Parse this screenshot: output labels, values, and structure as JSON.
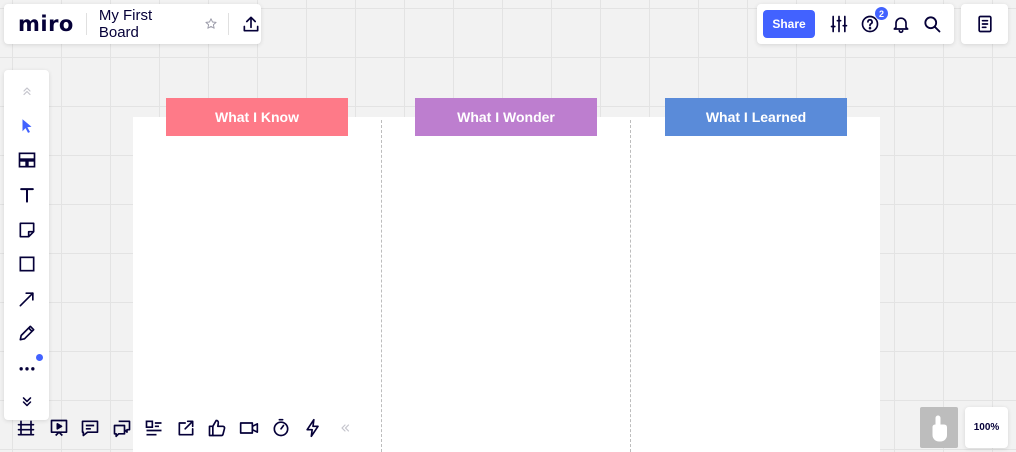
{
  "header": {
    "logo": "miro",
    "board_title": "My First Board",
    "share_label": "Share",
    "help_badge_count": "2"
  },
  "icons": {
    "star": "star-icon",
    "upload": "upload-icon",
    "settings": "sliders-icon",
    "help": "help-icon",
    "notifications": "bell-icon",
    "search": "search-icon",
    "notes": "notes-icon"
  },
  "left_toolbar": {
    "tools": [
      "collapse-up",
      "select",
      "templates",
      "text",
      "sticky-note",
      "shape",
      "connection-line",
      "pen",
      "more",
      "expand-down"
    ]
  },
  "bottom_toolbar": {
    "tools": [
      "frames",
      "presentation",
      "comments",
      "chat",
      "card",
      "share-screen",
      "voting",
      "video-call",
      "timer",
      "activity",
      "collapse"
    ]
  },
  "board": {
    "columns": [
      {
        "title": "What I Know",
        "color": "#fe7a88"
      },
      {
        "title": "What I Wonder",
        "color": "#bd7ecf"
      },
      {
        "title": "What I Learned",
        "color": "#5a8bd9"
      }
    ]
  },
  "zoom": {
    "level": "100%"
  },
  "colors": {
    "accent": "#4262ff",
    "ink": "#050038"
  }
}
